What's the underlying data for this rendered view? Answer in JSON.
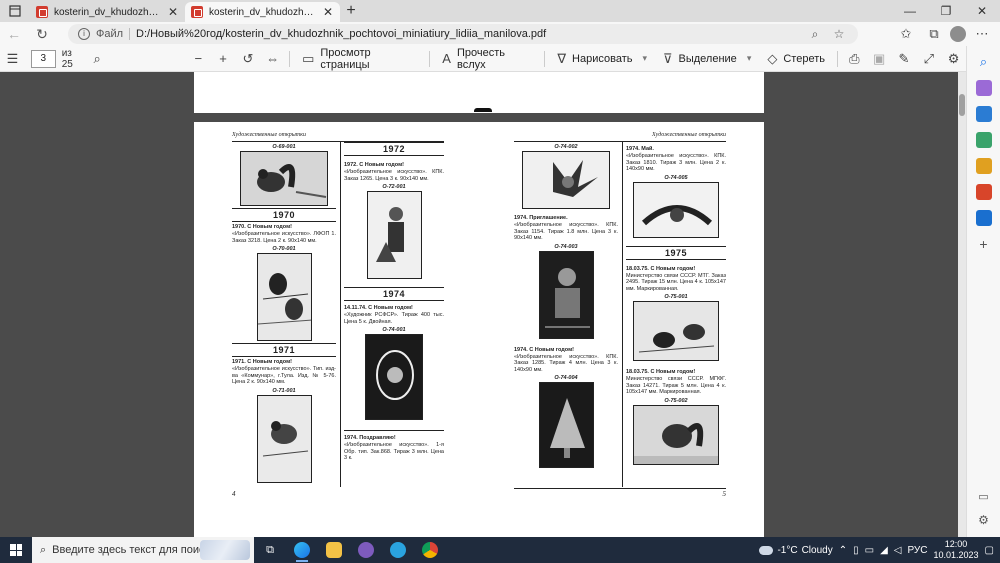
{
  "browser": {
    "tabs": [
      {
        "title": "kosterin_dv_khudozhnik_pochtovoi_miniatiury_lidiia_manilova.pdf",
        "active": false
      },
      {
        "title": "kosterin_dv_khudozhnik_pochtovoi_miniatiury_lidiia_manilova.pdf",
        "active": true
      }
    ],
    "address": {
      "scheme": "Файл",
      "url": "D:/Новый%20год/kosterin_dv_khudozhnik_pochtovoi_miniatiury_lidiia_manilova.pdf"
    }
  },
  "pdf_toolbar": {
    "page_number": "3",
    "page_count": "из 25",
    "page_view": "Просмотр страницы",
    "read_aloud": "Прочесть вслух",
    "draw": "Нарисовать",
    "highlight": "Выделение",
    "erase": "Стереть"
  },
  "left_page": {
    "running_head": "Художественные открытки",
    "page_number": "4",
    "col1": {
      "code1": "О-69-001",
      "year1": "1970",
      "entry1_title": "1970. С Новым годом!",
      "entry1_text": "«Изобразительное искусство». ЛФОП 1. Заказ 3218. Цена 2 к. 90х140 мм.",
      "code2": "О-70-001",
      "year2": "1971",
      "entry2_title": "1971. С Новым годом!",
      "entry2_text": "«Изобразительное искусство». Тип. изд-ва «Коммунар», г.Тула. Изд. № 5-76. Цена 2 к. 90х140 мм.",
      "code3": "О-71-001"
    },
    "col2": {
      "year1": "1972",
      "entry1_title": "1972. С Новым годом!",
      "entry1_text": "«Изобразительное искусство». КПК. Заказ 1265. Цена 3 к. 90х140 мм.",
      "code1": "О-72-001",
      "year2": "1974",
      "entry2_title": "14.11.74. С Новым годом!",
      "entry2_text": "«Художник РСФСР». Тираж 400 тыс. Цена 5 к. Двойная.",
      "code2": "О-74-001",
      "entry3_title": "1974. Поздравляю!",
      "entry3_text": "«Изобразительное искусство». 1-я Обр. тип. Зак.868. Тираж 3 млн. Цена 3 к."
    }
  },
  "right_page": {
    "running_head": "Художественные открытки",
    "page_number": "5",
    "col1": {
      "code1": "О-74-002",
      "entry1_title": "1974. Приглашение.",
      "entry1_text": "«Изобразительное искусство». КПК. Заказ 1154. Тираж 1.8 млн. Цена 3 к. 90х140 мм.",
      "code2": "О-74-003",
      "entry2_title": "1974. С Новым годом!",
      "entry2_text": "«Изобразительное искусство». КПК. Заказ 1285. Тираж 4 млн. Цена 3 к. 140х90 мм.",
      "code3": "О-74-004"
    },
    "col2": {
      "entry1_title": "1974. Май.",
      "entry1_text": "«Изобразительное искусство». КПК. Заказ 1810. Тираж 3 млн. Цена 2 к. 140х90 мм.",
      "code1": "О-74-005",
      "year1": "1975",
      "entry2_title": "18.03.75. С Новым годом!",
      "entry2_text": "Министерство связи СССР. МТГ. Заказ 2495. Тираж 15 млн. Цена 4 к. 105х147 мм. Маркированная.",
      "code2": "О-75-001",
      "entry3_title": "18.03.75. С Новым годом!",
      "entry3_text": "Министерство связи СССР. МПФГ. Заказ 14271. Тираж 5 млн. Цена 4 к. 105х147 мм. Маркированная.",
      "code3": "О-75-002"
    }
  },
  "taskbar": {
    "search_placeholder": "Введите здесь текст для поиска",
    "temperature": "-1°C",
    "weather": "Cloudy",
    "language": "РУС",
    "time": "12:00",
    "date": "10.01.2023"
  },
  "colors": {
    "edge_blue": "#1a73e8",
    "pdf_red": "#d23c2f",
    "taskbar": "#1f2b3d"
  }
}
